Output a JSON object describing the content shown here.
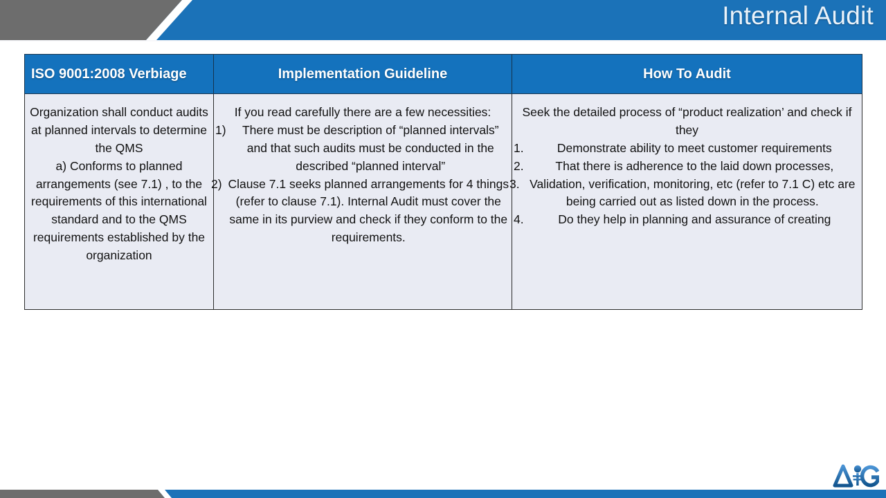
{
  "banner": {
    "title": "Internal Audit",
    "accent_blue": "#1b72b8",
    "gray": "#6d6d6d"
  },
  "table": {
    "headers": [
      "ISO 9001:2008 Verbiage",
      "Implementation Guideline",
      "How To Audit"
    ],
    "header_bg": "#1472bd",
    "cell_bg": "#e9ebf3",
    "col1": {
      "lines": [
        "Organization shall conduct audits at planned intervals to determine the QMS",
        "a) Conforms to planned arrangements (see 7.1) , to the requirements of this international standard and to the QMS requirements established by the organization"
      ]
    },
    "col2": {
      "lead": "If you read carefully there are a few necessities:",
      "items": [
        {
          "marker": "1)",
          "text": "There must be description of “planned intervals” and that such audits must be conducted in the described “planned interval”"
        },
        {
          "marker": "2)",
          "text": "Clause 7.1 seeks planned arrangements for 4 things (refer to clause 7.1). Internal Audit must cover the same in its purview and check if they conform to the requirements."
        }
      ]
    },
    "col3": {
      "lead": "Seek the detailed process of “product realization’ and check if they",
      "items": [
        {
          "marker": "1.",
          "text": "Demonstrate ability to meet customer requirements"
        },
        {
          "marker": "2.",
          "text": "That there is adherence to the laid down processes,"
        },
        {
          "marker": "3.",
          "text": "Validation, verification, monitoring, etc (refer to 7.1 C) etc are being carried out as listed down in the process."
        },
        {
          "marker": "4.",
          "text": "Do they help in planning and assurance of creating"
        }
      ]
    }
  },
  "logo": {
    "name": "aig-logo",
    "letter_left": "A",
    "letter_right": "G",
    "color": "#1d6fb5"
  }
}
